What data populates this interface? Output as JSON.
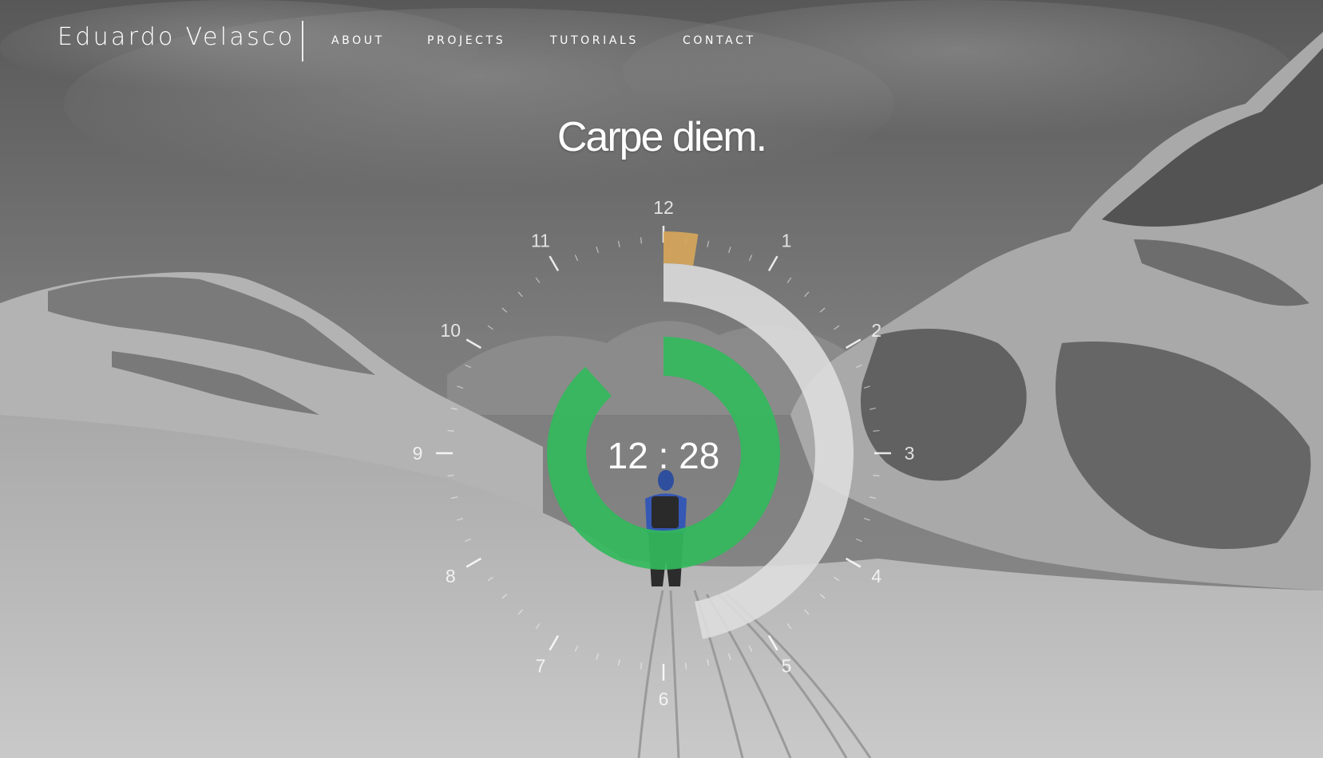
{
  "nav": {
    "brand": "Eduardo Velasco",
    "links": [
      {
        "label": "ABOUT"
      },
      {
        "label": "PROJECTS"
      },
      {
        "label": "TUTORIALS"
      },
      {
        "label": "CONTACT"
      }
    ]
  },
  "hero": {
    "headline": "Carpe diem."
  },
  "clock": {
    "hour_numerals": [
      "12",
      "1",
      "2",
      "3",
      "4",
      "5",
      "6",
      "7",
      "8",
      "9",
      "10",
      "11"
    ],
    "display": {
      "hours": "12",
      "separator": ":",
      "minutes": "28"
    },
    "rings": [
      {
        "name": "hours-ring",
        "fraction": 0.015,
        "color": "#d6a65a"
      },
      {
        "name": "minutes-ring",
        "fraction": 0.467,
        "color": "#dedede"
      },
      {
        "name": "seconds-ring",
        "fraction": 0.883,
        "color": "#33b85c"
      }
    ]
  }
}
